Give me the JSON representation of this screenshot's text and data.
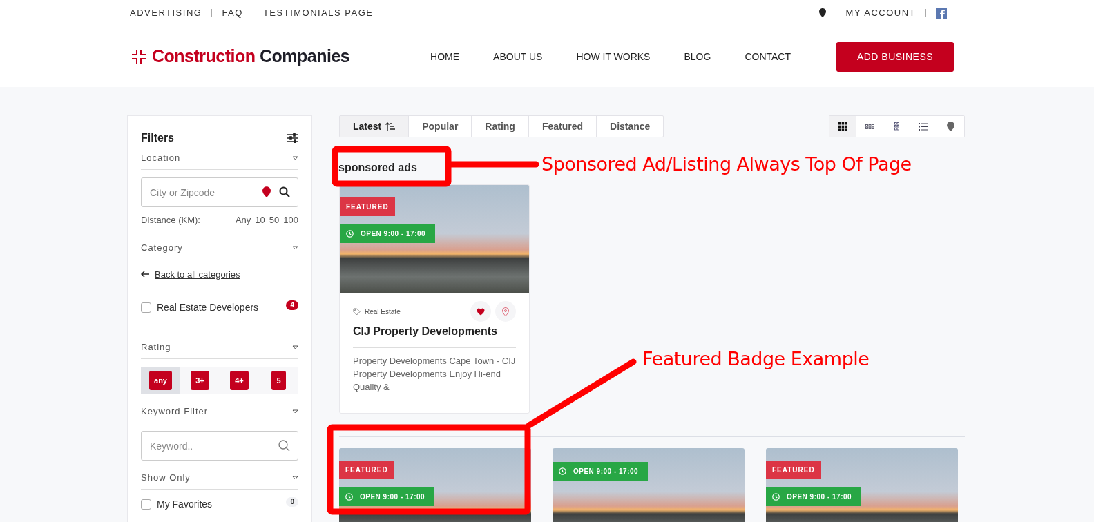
{
  "top_bar": {
    "links": [
      "ADVERTISING",
      "FAQ",
      "TESTIMONIALS PAGE"
    ],
    "account": "MY ACCOUNT"
  },
  "header": {
    "logo": {
      "first": "Construction",
      "second": "Companies"
    },
    "nav": [
      "HOME",
      "ABOUT US",
      "HOW IT WORKS",
      "BLOG",
      "CONTACT"
    ],
    "cta": "ADD BUSINESS"
  },
  "filters": {
    "title": "Filters",
    "location": {
      "heading": "Location",
      "placeholder": "City or Zipcode",
      "distance_label": "Distance (KM):",
      "distances": [
        {
          "label": "Any",
          "selected": true
        },
        {
          "label": "10",
          "selected": false
        },
        {
          "label": "50",
          "selected": false
        },
        {
          "label": "100",
          "selected": false
        }
      ]
    },
    "category": {
      "heading": "Category",
      "back_link": "Back to all categories",
      "items": [
        {
          "label": "Real Estate Developers",
          "count": "4",
          "checked": false
        }
      ]
    },
    "rating": {
      "heading": "Rating",
      "options": [
        {
          "label": "any",
          "selected": true
        },
        {
          "label": "3+",
          "selected": false
        },
        {
          "label": "4+",
          "selected": false
        },
        {
          "label": "5",
          "selected": false
        }
      ]
    },
    "keyword": {
      "heading": "Keyword Filter",
      "placeholder": "Keyword.."
    },
    "show_only": {
      "heading": "Show Only",
      "items": [
        {
          "label": "My Favorites",
          "count": "0",
          "checked": false
        }
      ]
    }
  },
  "sort_tabs": [
    {
      "label": "Latest",
      "selected": true
    },
    {
      "label": "Popular",
      "selected": false
    },
    {
      "label": "Rating",
      "selected": false
    },
    {
      "label": "Featured",
      "selected": false
    },
    {
      "label": "Distance",
      "selected": false
    }
  ],
  "view_modes": [
    {
      "kind": "grid3",
      "selected": true
    },
    {
      "kind": "grid-small",
      "selected": false
    },
    {
      "kind": "grid2",
      "selected": false
    },
    {
      "kind": "list",
      "selected": false
    },
    {
      "kind": "map",
      "selected": false
    }
  ],
  "sponsored": {
    "heading": "sponsored ads",
    "listings": [
      {
        "featured": true,
        "featured_label": "FEATURED",
        "hours": "OPEN 9:00 - 17:00",
        "category": "Real Estate",
        "title": "CIJ Property Developments",
        "description": "Property Developments Cape Town - CIJ Property Developments Enjoy Hi-end Quality &",
        "favorite": true
      }
    ]
  },
  "listings": [
    {
      "featured": true,
      "featured_label": "FEATURED",
      "hours": "OPEN 9:00 - 17:00"
    },
    {
      "featured": false,
      "hours": "OPEN 9:00 - 17:00"
    },
    {
      "featured": true,
      "featured_label": "FEATURED",
      "hours": "OPEN 9:00 - 17:00"
    }
  ],
  "annotations": [
    "Sponsored Ad/Listing Always Top Of Page",
    "Featured Badge Example"
  ]
}
